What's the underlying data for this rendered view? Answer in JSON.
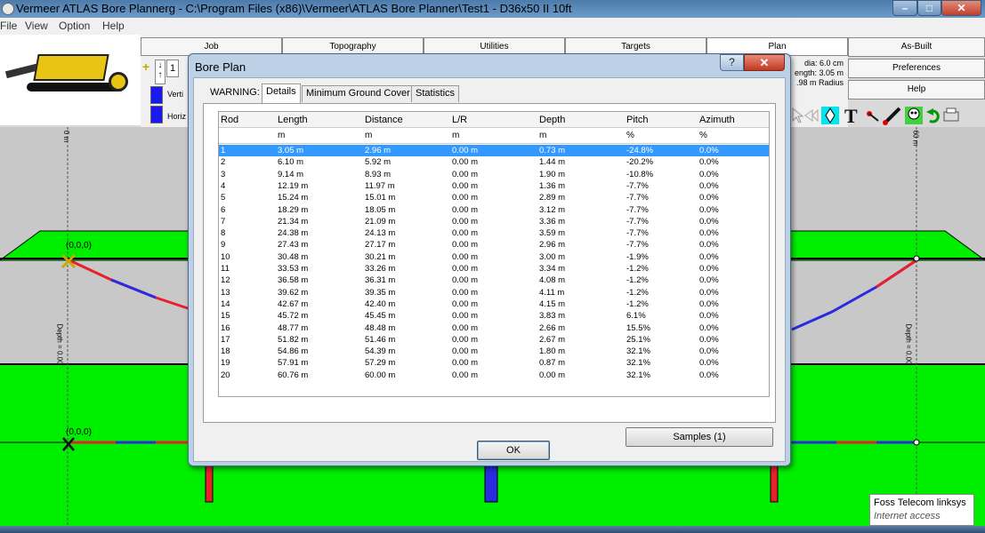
{
  "window": {
    "title": "Vermeer ATLAS Bore Plannerg - C:\\Program Files (x86)\\Vermeer\\ATLAS Bore Planner\\Test1 - D36x50 II 10ft",
    "minimize": "–",
    "maximize": "□",
    "close": "✕"
  },
  "menu": [
    "File",
    "View",
    "Option",
    "Help"
  ],
  "tabs": [
    "Job",
    "Topography",
    "Utilities",
    "Targets",
    "Plan",
    "As-Built"
  ],
  "side_buttons": [
    "Preferences",
    "Help"
  ],
  "controls": {
    "rod_count": "1",
    "vertical_label": "Verti",
    "horizontal_label": "Horiz",
    "info_lines": [
      "dia: 6.0 cm",
      "ength: 3.05 m",
      ".98 m Radius"
    ]
  },
  "drawing": {
    "origin_top": "(0,0,0)",
    "origin_bottom": "(0,0,0)",
    "left_ruler_top": "0 m",
    "right_ruler_top": "60 m",
    "depth_label": "Depth = 0.00"
  },
  "dialog": {
    "title": "Bore Plan",
    "help_button": "?",
    "close_button": "✕",
    "warning_label": "WARNING:",
    "tabs": [
      "Details",
      "Minimum Ground Cover",
      "Statistics"
    ],
    "active_tab": "Details",
    "columns": [
      "Rod",
      "Length",
      "Distance",
      "L/R",
      "Depth",
      "Pitch",
      "Azimuth"
    ],
    "units": [
      "",
      "m",
      "m",
      "m",
      "m",
      "%",
      "%"
    ],
    "rows": [
      [
        "1",
        "3.05 m",
        "2.96 m",
        "0.00 m",
        "0.73 m",
        "-24.8%",
        "0.0%"
      ],
      [
        "2",
        "6.10 m",
        "5.92 m",
        "0.00 m",
        "1.44 m",
        "-20.2%",
        "0.0%"
      ],
      [
        "3",
        "9.14 m",
        "8.93 m",
        "0.00 m",
        "1.90 m",
        "-10.8%",
        "0.0%"
      ],
      [
        "4",
        "12.19 m",
        "11.97 m",
        "0.00 m",
        "1.36 m",
        "-7.7%",
        "0.0%"
      ],
      [
        "5",
        "15.24 m",
        "15.01 m",
        "0.00 m",
        "2.89 m",
        "-7.7%",
        "0.0%"
      ],
      [
        "6",
        "18.29 m",
        "18.05 m",
        "0.00 m",
        "3.12 m",
        "-7.7%",
        "0.0%"
      ],
      [
        "7",
        "21.34 m",
        "21.09 m",
        "0.00 m",
        "3.36 m",
        "-7.7%",
        "0.0%"
      ],
      [
        "8",
        "24.38 m",
        "24.13 m",
        "0.00 m",
        "3.59 m",
        "-7.7%",
        "0.0%"
      ],
      [
        "9",
        "27.43 m",
        "27.17 m",
        "0.00 m",
        "2.96 m",
        "-7.7%",
        "0.0%"
      ],
      [
        "10",
        "30.48 m",
        "30.21 m",
        "0.00 m",
        "3.00 m",
        "-1.9%",
        "0.0%"
      ],
      [
        "11",
        "33.53 m",
        "33.26 m",
        "0.00 m",
        "3.34 m",
        "-1.2%",
        "0.0%"
      ],
      [
        "12",
        "36.58 m",
        "36.31 m",
        "0.00 m",
        "4.08 m",
        "-1.2%",
        "0.0%"
      ],
      [
        "13",
        "39.62 m",
        "39.35 m",
        "0.00 m",
        "4.11 m",
        "-1.2%",
        "0.0%"
      ],
      [
        "14",
        "42.67 m",
        "42.40 m",
        "0.00 m",
        "4.15 m",
        "-1.2%",
        "0.0%"
      ],
      [
        "15",
        "45.72 m",
        "45.45 m",
        "0.00 m",
        "3.83 m",
        "6.1%",
        "0.0%"
      ],
      [
        "16",
        "48.77 m",
        "48.48 m",
        "0.00 m",
        "2.66 m",
        "15.5%",
        "0.0%"
      ],
      [
        "17",
        "51.82 m",
        "51.46 m",
        "0.00 m",
        "2.67 m",
        "25.1%",
        "0.0%"
      ],
      [
        "18",
        "54.86 m",
        "54.39 m",
        "0.00 m",
        "1.80 m",
        "32.1%",
        "0.0%"
      ],
      [
        "19",
        "57.91 m",
        "57.29 m",
        "0.00 m",
        "0.87 m",
        "32.1%",
        "0.0%"
      ],
      [
        "20",
        "60.76 m",
        "60.00 m",
        "0.00 m",
        "0.00 m",
        "32.1%",
        "0.0%"
      ]
    ],
    "selected_row": 0,
    "samples_button": "Samples (1)",
    "ok_button": "OK"
  },
  "tray_popup": {
    "network": "Foss Telecom linksys",
    "status": "Internet access"
  },
  "colors": {
    "ground": "#00ee00",
    "bore_red": "#e8202a",
    "bore_blue": "#2a2ae0",
    "selection": "#3399ff"
  }
}
